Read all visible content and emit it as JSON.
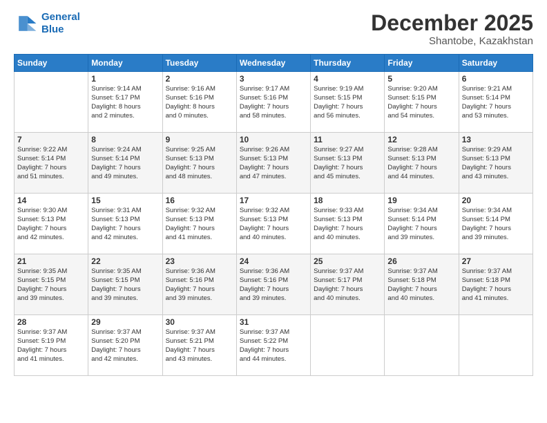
{
  "logo": {
    "line1": "General",
    "line2": "Blue"
  },
  "header": {
    "month": "December 2025",
    "location": "Shantobe, Kazakhstan"
  },
  "days_header": [
    "Sunday",
    "Monday",
    "Tuesday",
    "Wednesday",
    "Thursday",
    "Friday",
    "Saturday"
  ],
  "weeks": [
    [
      {
        "day": "",
        "content": ""
      },
      {
        "day": "1",
        "content": "Sunrise: 9:14 AM\nSunset: 5:17 PM\nDaylight: 8 hours\nand 2 minutes."
      },
      {
        "day": "2",
        "content": "Sunrise: 9:16 AM\nSunset: 5:16 PM\nDaylight: 8 hours\nand 0 minutes."
      },
      {
        "day": "3",
        "content": "Sunrise: 9:17 AM\nSunset: 5:16 PM\nDaylight: 7 hours\nand 58 minutes."
      },
      {
        "day": "4",
        "content": "Sunrise: 9:19 AM\nSunset: 5:15 PM\nDaylight: 7 hours\nand 56 minutes."
      },
      {
        "day": "5",
        "content": "Sunrise: 9:20 AM\nSunset: 5:15 PM\nDaylight: 7 hours\nand 54 minutes."
      },
      {
        "day": "6",
        "content": "Sunrise: 9:21 AM\nSunset: 5:14 PM\nDaylight: 7 hours\nand 53 minutes."
      }
    ],
    [
      {
        "day": "7",
        "content": "Sunrise: 9:22 AM\nSunset: 5:14 PM\nDaylight: 7 hours\nand 51 minutes."
      },
      {
        "day": "8",
        "content": "Sunrise: 9:24 AM\nSunset: 5:14 PM\nDaylight: 7 hours\nand 49 minutes."
      },
      {
        "day": "9",
        "content": "Sunrise: 9:25 AM\nSunset: 5:13 PM\nDaylight: 7 hours\nand 48 minutes."
      },
      {
        "day": "10",
        "content": "Sunrise: 9:26 AM\nSunset: 5:13 PM\nDaylight: 7 hours\nand 47 minutes."
      },
      {
        "day": "11",
        "content": "Sunrise: 9:27 AM\nSunset: 5:13 PM\nDaylight: 7 hours\nand 45 minutes."
      },
      {
        "day": "12",
        "content": "Sunrise: 9:28 AM\nSunset: 5:13 PM\nDaylight: 7 hours\nand 44 minutes."
      },
      {
        "day": "13",
        "content": "Sunrise: 9:29 AM\nSunset: 5:13 PM\nDaylight: 7 hours\nand 43 minutes."
      }
    ],
    [
      {
        "day": "14",
        "content": "Sunrise: 9:30 AM\nSunset: 5:13 PM\nDaylight: 7 hours\nand 42 minutes."
      },
      {
        "day": "15",
        "content": "Sunrise: 9:31 AM\nSunset: 5:13 PM\nDaylight: 7 hours\nand 42 minutes."
      },
      {
        "day": "16",
        "content": "Sunrise: 9:32 AM\nSunset: 5:13 PM\nDaylight: 7 hours\nand 41 minutes."
      },
      {
        "day": "17",
        "content": "Sunrise: 9:32 AM\nSunset: 5:13 PM\nDaylight: 7 hours\nand 40 minutes."
      },
      {
        "day": "18",
        "content": "Sunrise: 9:33 AM\nSunset: 5:13 PM\nDaylight: 7 hours\nand 40 minutes."
      },
      {
        "day": "19",
        "content": "Sunrise: 9:34 AM\nSunset: 5:14 PM\nDaylight: 7 hours\nand 39 minutes."
      },
      {
        "day": "20",
        "content": "Sunrise: 9:34 AM\nSunset: 5:14 PM\nDaylight: 7 hours\nand 39 minutes."
      }
    ],
    [
      {
        "day": "21",
        "content": "Sunrise: 9:35 AM\nSunset: 5:15 PM\nDaylight: 7 hours\nand 39 minutes."
      },
      {
        "day": "22",
        "content": "Sunrise: 9:35 AM\nSunset: 5:15 PM\nDaylight: 7 hours\nand 39 minutes."
      },
      {
        "day": "23",
        "content": "Sunrise: 9:36 AM\nSunset: 5:16 PM\nDaylight: 7 hours\nand 39 minutes."
      },
      {
        "day": "24",
        "content": "Sunrise: 9:36 AM\nSunset: 5:16 PM\nDaylight: 7 hours\nand 39 minutes."
      },
      {
        "day": "25",
        "content": "Sunrise: 9:37 AM\nSunset: 5:17 PM\nDaylight: 7 hours\nand 40 minutes."
      },
      {
        "day": "26",
        "content": "Sunrise: 9:37 AM\nSunset: 5:18 PM\nDaylight: 7 hours\nand 40 minutes."
      },
      {
        "day": "27",
        "content": "Sunrise: 9:37 AM\nSunset: 5:18 PM\nDaylight: 7 hours\nand 41 minutes."
      }
    ],
    [
      {
        "day": "28",
        "content": "Sunrise: 9:37 AM\nSunset: 5:19 PM\nDaylight: 7 hours\nand 41 minutes."
      },
      {
        "day": "29",
        "content": "Sunrise: 9:37 AM\nSunset: 5:20 PM\nDaylight: 7 hours\nand 42 minutes."
      },
      {
        "day": "30",
        "content": "Sunrise: 9:37 AM\nSunset: 5:21 PM\nDaylight: 7 hours\nand 43 minutes."
      },
      {
        "day": "31",
        "content": "Sunrise: 9:37 AM\nSunset: 5:22 PM\nDaylight: 7 hours\nand 44 minutes."
      },
      {
        "day": "",
        "content": ""
      },
      {
        "day": "",
        "content": ""
      },
      {
        "day": "",
        "content": ""
      }
    ]
  ]
}
